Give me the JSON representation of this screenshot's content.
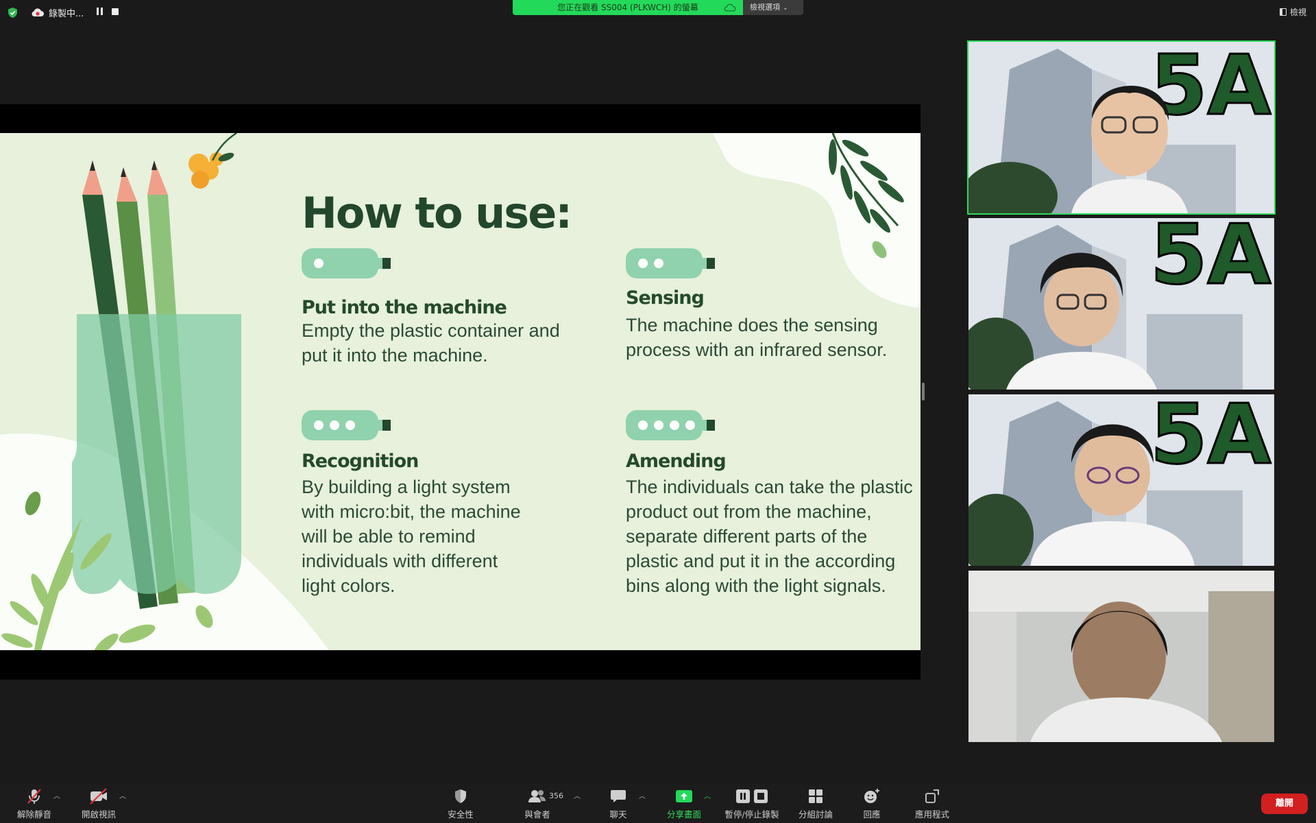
{
  "topbar": {
    "recording_label": "錄製中...",
    "banner_text": "您正在觀看 SS004 (PLKWCH) 的螢幕",
    "view_options_label": "檢視選項",
    "view_label": "檢視"
  },
  "slide": {
    "title": "How to use:",
    "steps": [
      {
        "dots": 1,
        "heading": "Put into the machine",
        "text": "Empty the plastic container and put it into the machine."
      },
      {
        "dots": 2,
        "heading": "Sensing",
        "text": "The machine does the sensing process with an infrared sensor."
      },
      {
        "dots": 3,
        "heading": "Recognition",
        "text": "By building a light system with micro:bit, the machine will be able to remind individuals with different light colors."
      },
      {
        "dots": 4,
        "heading": "Amending",
        "text": "The individuals can take the plastic product out from the machine, separate different parts of the plastic and put it in the according bins along with the light signals."
      }
    ]
  },
  "participants": [
    {
      "active": true,
      "background_text": "5A"
    },
    {
      "active": false,
      "background_text": "5A"
    },
    {
      "active": false,
      "background_text": "5A"
    },
    {
      "active": false,
      "background_text": ""
    }
  ],
  "toolbar": {
    "unmute": "解除靜音",
    "start_video": "開啟視訊",
    "security": "安全性",
    "participants": "與會者",
    "participant_count": "356",
    "chat": "聊天",
    "share_screen": "分享畫面",
    "pause_stop_recording": "暫停/停止錄製",
    "breakout_rooms": "分組討論",
    "reactions": "回應",
    "apps": "應用程式",
    "leave": "離開"
  },
  "colors": {
    "share_green": "#23d959",
    "leave_red": "#d21f1f",
    "slide_bg": "#e7f1dc",
    "slide_dark_green": "#22472c",
    "active_outline": "#2edc5c"
  }
}
